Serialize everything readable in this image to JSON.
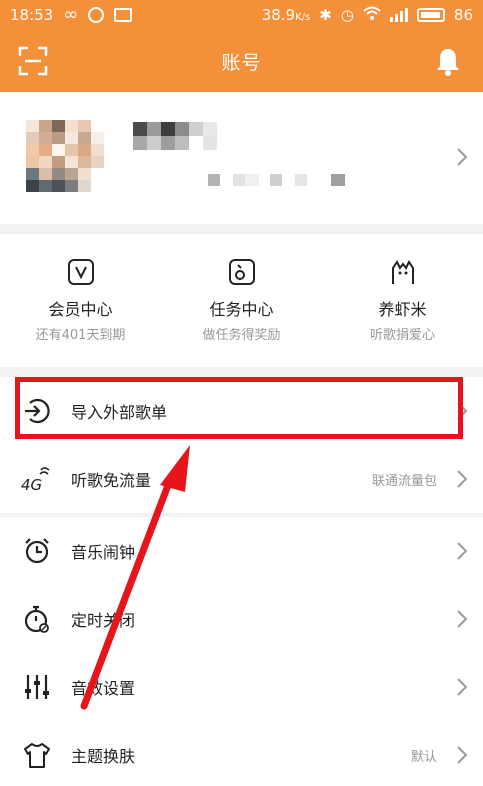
{
  "status_bar": {
    "time": "18:53",
    "speed": "38.9",
    "speed_unit": "K/s",
    "battery": "86"
  },
  "header": {
    "title": "账号"
  },
  "profile": {},
  "quick_actions": [
    {
      "label": "会员中心",
      "sub": "还有401天到期",
      "icon": "vip-icon"
    },
    {
      "label": "任务中心",
      "sub": "做任务得奖励",
      "icon": "task-icon"
    },
    {
      "label": "养虾米",
      "sub": "听歌捐爱心",
      "icon": "shrimp-icon"
    }
  ],
  "menu_group_1": [
    {
      "label": "导入外部歌单",
      "value": "",
      "icon": "import-icon"
    },
    {
      "label": "听歌免流量",
      "value": "联通流量包",
      "icon": "4g-icon"
    }
  ],
  "menu_group_2": [
    {
      "label": "音乐闹钟",
      "value": "",
      "icon": "alarm-clock-icon"
    },
    {
      "label": "定时关闭",
      "value": "",
      "icon": "timer-icon"
    },
    {
      "label": "音效设置",
      "value": "",
      "icon": "equalizer-icon"
    },
    {
      "label": "主题换肤",
      "value": "默认",
      "icon": "tshirt-icon"
    }
  ],
  "annotation": {
    "highlight_color": "#e8141b"
  },
  "colors": {
    "brand": "#f5903a",
    "separator": "#f2f2f2",
    "secondary_text": "#999999"
  }
}
